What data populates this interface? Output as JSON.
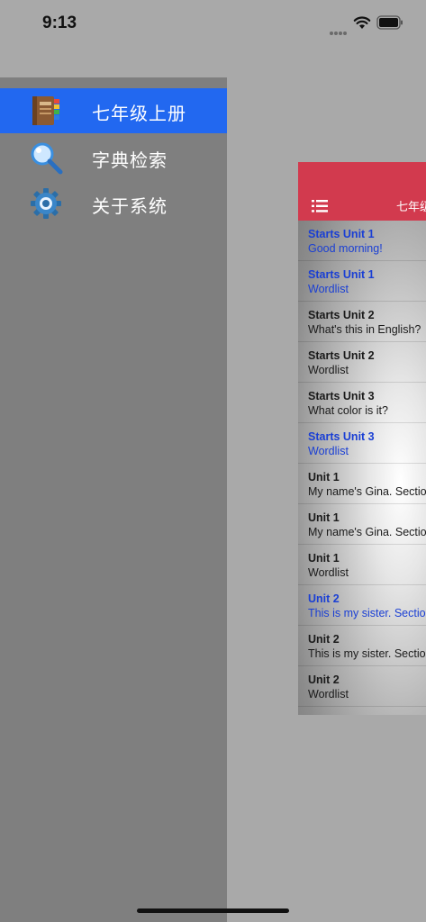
{
  "status_bar": {
    "time": "9:13"
  },
  "side_menu": {
    "items": [
      {
        "label": "七年级上册",
        "icon": "book-icon",
        "active": true
      },
      {
        "label": "字典检索",
        "icon": "magnifier-icon",
        "active": false
      },
      {
        "label": "关于系统",
        "icon": "gear-icon",
        "active": false
      }
    ]
  },
  "main": {
    "nav_title": "七年级",
    "list": [
      {
        "title": "Starts Unit 1",
        "subtitle": "Good morning!",
        "highlight": true
      },
      {
        "title": "Starts Unit 1",
        "subtitle": "Wordlist",
        "highlight": true
      },
      {
        "title": "Starts Unit 2",
        "subtitle": "What's this in English?",
        "highlight": false
      },
      {
        "title": "Starts Unit 2",
        "subtitle": "Wordlist",
        "highlight": false
      },
      {
        "title": "Starts Unit 3",
        "subtitle": "What color is it?",
        "highlight": false
      },
      {
        "title": "Starts Unit 3",
        "subtitle": "Wordlist",
        "highlight": true
      },
      {
        "title": "Unit 1",
        "subtitle": "My name's Gina. Section",
        "highlight": false
      },
      {
        "title": "Unit 1",
        "subtitle": "My name's Gina. Section",
        "highlight": false
      },
      {
        "title": "Unit 1",
        "subtitle": "Wordlist",
        "highlight": false
      },
      {
        "title": "Unit 2",
        "subtitle": "This is my sister. Section",
        "highlight": true
      },
      {
        "title": "Unit 2",
        "subtitle": "This is my sister. Section",
        "highlight": false
      },
      {
        "title": "Unit 2",
        "subtitle": "Wordlist",
        "highlight": false
      }
    ]
  },
  "colors": {
    "menu_active": "#2268f0",
    "nav_bar": "#d23a4e",
    "highlight_text": "#1a3fd4"
  }
}
